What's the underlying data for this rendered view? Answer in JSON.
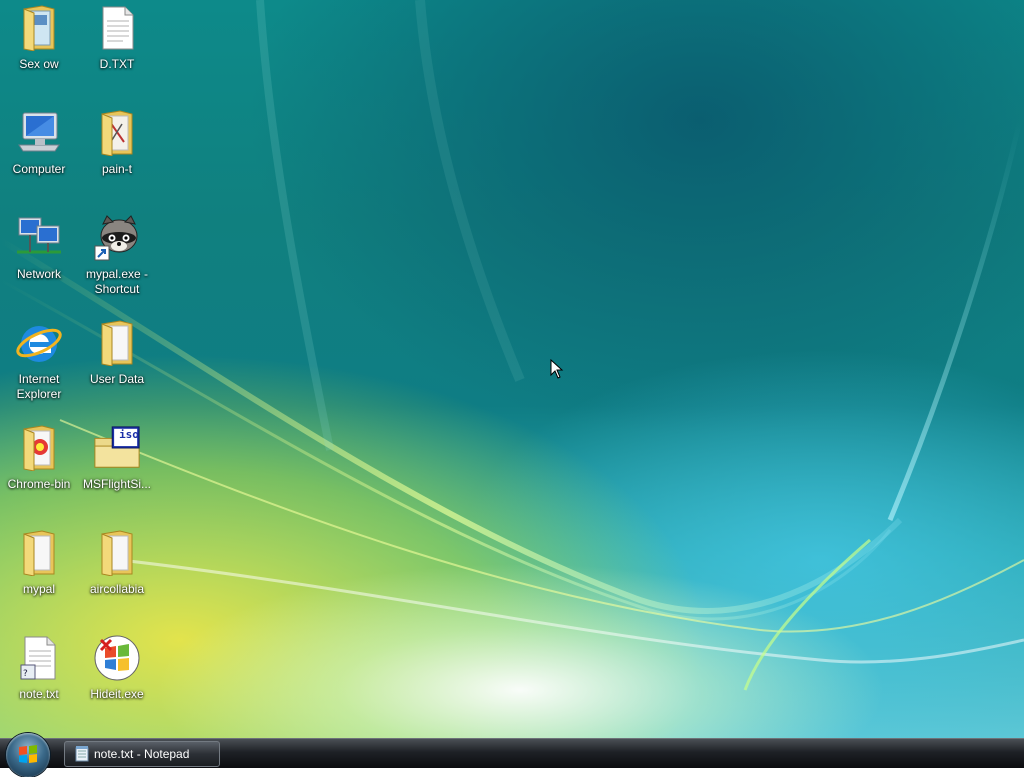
{
  "desktop": {
    "icons": [
      {
        "label": "Sex ow",
        "icon": "folder-icon"
      },
      {
        "label": "D.TXT",
        "icon": "text-file-icon"
      },
      {
        "label": "Computer",
        "icon": "computer-icon"
      },
      {
        "label": "pain-t",
        "icon": "folder-icon"
      },
      {
        "label": "Network",
        "icon": "network-icon"
      },
      {
        "label": "mypal.exe -\nShortcut",
        "icon": "raccoon-shortcut-icon"
      },
      {
        "label": "Internet\nExplorer",
        "icon": "internet-explorer-icon"
      },
      {
        "label": "User Data",
        "icon": "folder-icon"
      },
      {
        "label": "Chrome-bin",
        "icon": "folder-icon"
      },
      {
        "label": "MSFlightSi...",
        "icon": "iso-file-icon"
      },
      {
        "label": "mypal",
        "icon": "folder-icon"
      },
      {
        "label": "aircollabia",
        "icon": "folder-icon"
      },
      {
        "label": "note.txt",
        "icon": "text-file-icon"
      },
      {
        "label": "Hideit.exe",
        "icon": "windows-app-icon"
      }
    ],
    "iso_badge": "iso"
  },
  "taskbar": {
    "tasks": [
      {
        "label": "note.txt - Notepad",
        "icon": "notepad-icon"
      }
    ]
  },
  "colors": {
    "taskbar": "#1e2126",
    "accent": "#0d8a8a"
  }
}
